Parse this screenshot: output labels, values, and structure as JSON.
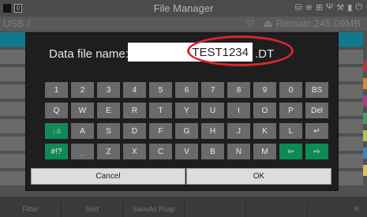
{
  "status_bar": {
    "left_badge": "0",
    "title": "File Manager",
    "right_icons": [
      "hdd-icon",
      "wifi-icon",
      "lan-icon",
      "usb-icon",
      "tool-icon",
      "battery-icon",
      "power-icon"
    ]
  },
  "path_bar": {
    "path": "USB /",
    "remain": "Remain:245.09MB"
  },
  "dialog": {
    "label": "Data file name:",
    "filename": "TEST1234",
    "extension": ".DT",
    "cancel_label": "Cancel",
    "ok_label": "OK"
  },
  "keyboard": {
    "row1": [
      "1",
      "2",
      "3",
      "4",
      "5",
      "6",
      "7",
      "8",
      "9",
      "0",
      "BS"
    ],
    "row2": [
      "Q",
      "W",
      "E",
      "R",
      "T",
      "Y",
      "U",
      "I",
      "O",
      "P",
      "Del"
    ],
    "row3": [
      "↓a",
      "A",
      "S",
      "D",
      "F",
      "G",
      "H",
      "J",
      "K",
      "L",
      "↵"
    ],
    "row4": [
      "#!?",
      "_",
      "Z",
      "X",
      "C",
      "V",
      "B",
      "N",
      "M",
      "⇦",
      "⇨"
    ]
  },
  "bottom_bar": {
    "items": [
      "Filter",
      "Sort",
      "SaveAs Pcap"
    ]
  },
  "colors": {
    "accent_teal": "#0f7a8e",
    "highlight_red": "#d9272e",
    "key_green": "#0f8a57"
  }
}
